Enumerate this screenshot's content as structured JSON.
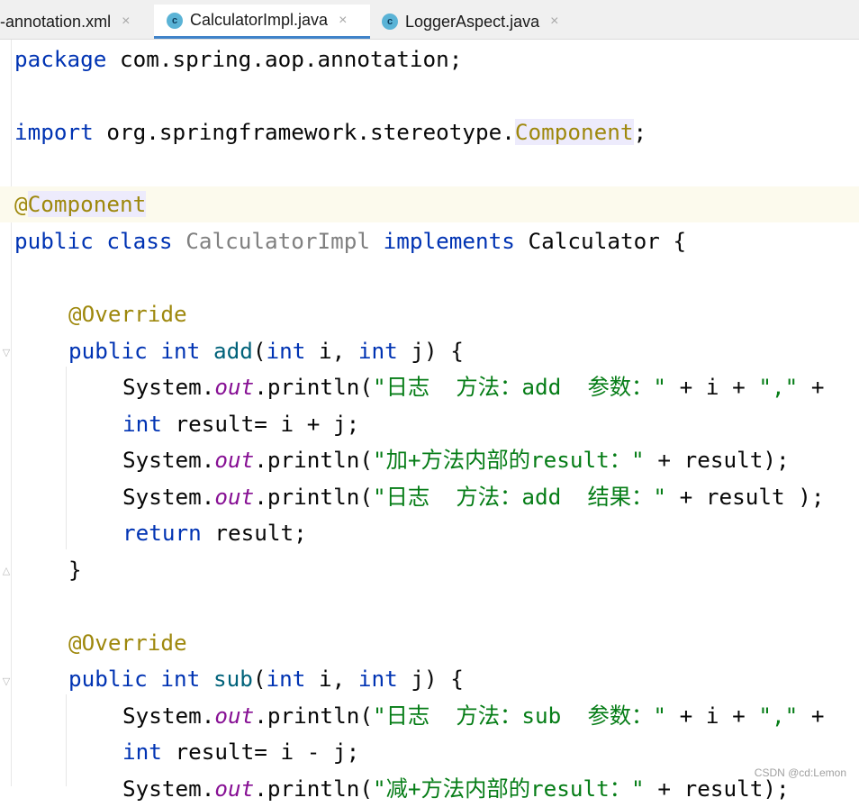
{
  "tabs": [
    {
      "label": "-annotation.xml",
      "icon": "",
      "close": "×",
      "active": false
    },
    {
      "label": "CalculatorImpl.java",
      "icon": "c",
      "close": "×",
      "active": true
    },
    {
      "label": "LoggerAspect.java",
      "icon": "c",
      "close": "×",
      "active": false
    }
  ],
  "code": {
    "l1": {
      "kw": "package",
      "rest": " com.spring.aop.annotation;"
    },
    "l3": {
      "kw": "import",
      "pre": " org.springframework.stereotype.",
      "ref": "Component",
      "semi": ";"
    },
    "l5": {
      "at": "@",
      "name": "Component"
    },
    "l6": {
      "kw1": "public",
      "kw2": "class",
      "cls": "CalculatorImpl",
      "kw3": "implements",
      "iface": " Calculator {"
    },
    "l8": {
      "ann": "@Override"
    },
    "l9": {
      "kw1": "public",
      "kw2": "int",
      "mth": "add",
      "p1": "(",
      "kw3": "int",
      "p2": " i, ",
      "kw4": "int",
      "p3": " j) {"
    },
    "l10": {
      "pre": "System.",
      "fld": "out",
      "call": ".println(",
      "str1": "\"日志  方法：add  参数：\"",
      "mid": " + i + ",
      "str2": "\",\"",
      "end": " +"
    },
    "l11": {
      "kw": "int",
      "rest": " result= i + j;"
    },
    "l12": {
      "pre": "System.",
      "fld": "out",
      "call": ".println(",
      "str": "\"加+方法内部的result：\"",
      "end": " + result);"
    },
    "l13": {
      "pre": "System.",
      "fld": "out",
      "call": ".println(",
      "str": "\"日志  方法：add  结果：\"",
      "end": " + result );"
    },
    "l14": {
      "kw": "return",
      "rest": " result;"
    },
    "l15": {
      "brace": "}"
    },
    "l17": {
      "ann": "@Override"
    },
    "l18": {
      "kw1": "public",
      "kw2": "int",
      "mth": "sub",
      "p1": "(",
      "kw3": "int",
      "p2": " i, ",
      "kw4": "int",
      "p3": " j) {"
    },
    "l19": {
      "pre": "System.",
      "fld": "out",
      "call": ".println(",
      "str1": "\"日志  方法：sub  参数：\"",
      "mid": " + i + ",
      "str2": "\",\"",
      "end": " +"
    },
    "l20": {
      "kw": "int",
      "rest": " result= i - j;"
    },
    "l21": {
      "pre": "System.",
      "fld": "out",
      "call": ".println(",
      "str": "\"减+方法内部的result：\"",
      "end": " + result);"
    }
  },
  "watermark": "CSDN @cd:Lemon",
  "colors": {
    "keyword": "#0033b3",
    "annotation": "#9e880d",
    "string": "#067d17",
    "field": "#871094",
    "method": "#00627a",
    "active_tab": "#4083c9"
  }
}
